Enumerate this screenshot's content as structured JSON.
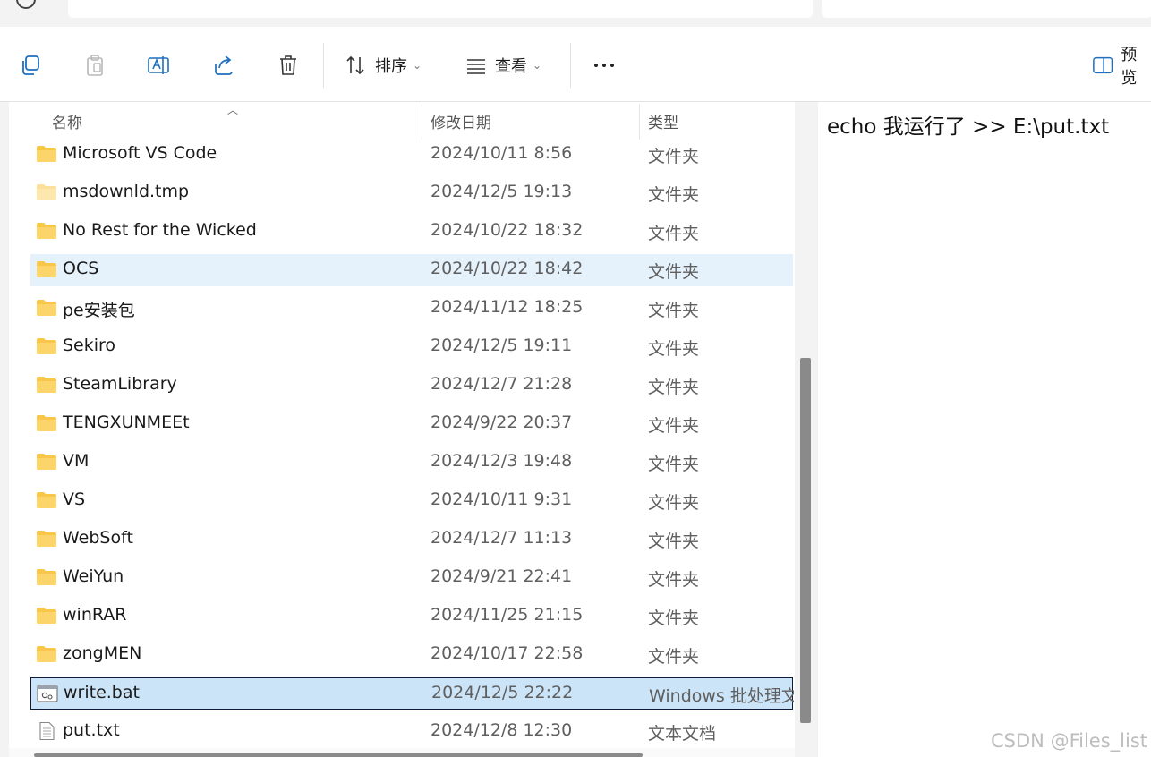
{
  "toolbar": {
    "sort_label": "排序",
    "view_label": "查看",
    "preview_label": "预览"
  },
  "columns": {
    "name": "名称",
    "date": "修改日期",
    "type": "类型"
  },
  "files": [
    {
      "name": "Microsoft VS Code",
      "date": "2024/10/11 8:56",
      "type": "文件夹",
      "icon": "folder-icon"
    },
    {
      "name": "msdownld.tmp",
      "date": "2024/12/5 19:13",
      "type": "文件夹",
      "icon": "folder-icon"
    },
    {
      "name": "No Rest for the Wicked",
      "date": "2024/10/22 18:32",
      "type": "文件夹",
      "icon": "folder-icon"
    },
    {
      "name": "OCS",
      "date": "2024/10/22 18:42",
      "type": "文件夹",
      "icon": "folder-icon",
      "state": "hover"
    },
    {
      "name": "pe安装包",
      "date": "2024/11/12 18:25",
      "type": "文件夹",
      "icon": "folder-icon"
    },
    {
      "name": "Sekiro",
      "date": "2024/12/5 19:11",
      "type": "文件夹",
      "icon": "folder-icon"
    },
    {
      "name": "SteamLibrary",
      "date": "2024/12/7 21:28",
      "type": "文件夹",
      "icon": "folder-icon"
    },
    {
      "name": "TENGXUNMEEt",
      "date": "2024/9/22 20:37",
      "type": "文件夹",
      "icon": "folder-icon"
    },
    {
      "name": "VM",
      "date": "2024/12/3 19:48",
      "type": "文件夹",
      "icon": "folder-icon"
    },
    {
      "name": "VS",
      "date": "2024/10/11 9:31",
      "type": "文件夹",
      "icon": "folder-icon"
    },
    {
      "name": "WebSoft",
      "date": "2024/12/7 11:13",
      "type": "文件夹",
      "icon": "folder-icon"
    },
    {
      "name": "WeiYun",
      "date": "2024/9/21 22:41",
      "type": "文件夹",
      "icon": "folder-icon"
    },
    {
      "name": "winRAR",
      "date": "2024/11/25 21:15",
      "type": "文件夹",
      "icon": "folder-icon"
    },
    {
      "name": "zongMEN",
      "date": "2024/10/17 22:58",
      "type": "文件夹",
      "icon": "folder-icon"
    },
    {
      "name": "write.bat",
      "date": "2024/12/5 22:22",
      "type": "Windows 批处理文件",
      "icon": "batch-file-icon",
      "state": "selected"
    },
    {
      "name": "put.txt",
      "date": "2024/12/8 12:30",
      "type": "文本文档",
      "icon": "text-file-icon"
    }
  ],
  "preview": {
    "content": "echo 我运行了 >> E:\\put.txt"
  },
  "watermark": "CSDN @Files_list",
  "colors": {
    "folder": "#f8c74a",
    "selected_bg": "#cce4f7",
    "hover_bg": "#e5f1fb"
  }
}
